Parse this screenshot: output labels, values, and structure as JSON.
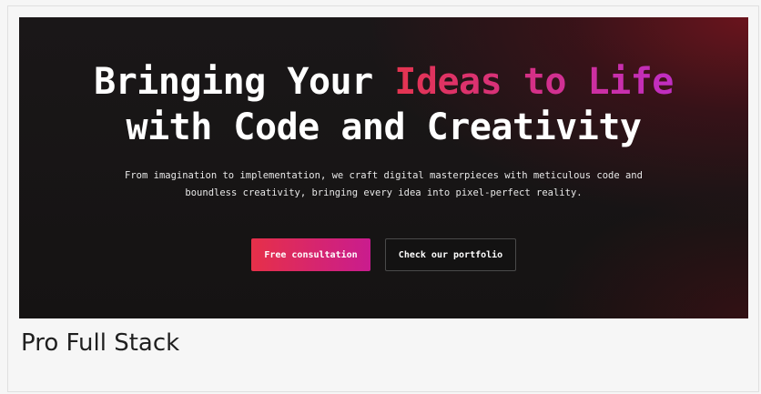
{
  "hero": {
    "headline_line1_plain": "Bringing Your ",
    "headline_line1_highlight": "Ideas to Life",
    "headline_line2": "with Code and Creativity",
    "subtitle_line1": "From imagination to implementation, we craft digital masterpieces with meticulous code and",
    "subtitle_line2": "boundless creativity, bringing every idea into pixel-perfect reality.",
    "primary_button_label": "Free consultation",
    "secondary_button_label": "Check our portfolio"
  },
  "caption": {
    "title": "Pro Full Stack"
  },
  "colors": {
    "gradient_start": "#e5344f",
    "gradient_end": "#c02ec3",
    "hero_background": "#151313",
    "hero_glow": "#6e1420",
    "page_background": "#f6f6f6"
  }
}
